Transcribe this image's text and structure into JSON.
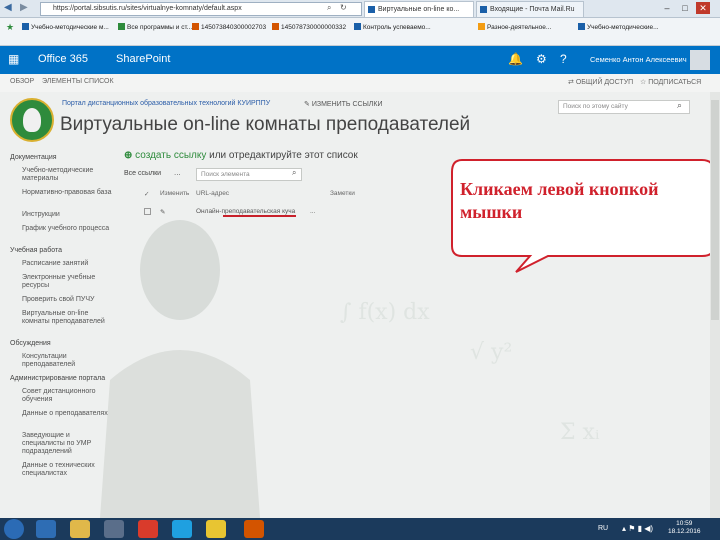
{
  "browser": {
    "address": "https://portal.sibsutis.ru/sites/virtualnye-komnaty/default.aspx",
    "tabs": [
      "Виртуальные on-line ко...",
      "Входящие - Почта Mail.Ru"
    ],
    "tab_colors": [
      "#1a5fa8",
      "#1a5fa8"
    ],
    "favorites": [
      "Учебно-методические м...",
      "Все программы и ст...",
      "145073840300002703",
      "145078730000000332",
      "Контроль успеваемо...",
      "Разное-деятельное...",
      "Учебно-методические..."
    ]
  },
  "suite": {
    "office": "Office 365",
    "app": "SharePoint",
    "user": "Семенко Антон Алексеевич",
    "bell_icon": "bell-icon",
    "gear_icon": "gear-icon",
    "help": "?"
  },
  "ribbon": {
    "left": [
      "ОБЗОР",
      "ЭЛЕМЕНТЫ",
      "СПИСОК"
    ],
    "share": "ОБЩИЙ ДОСТУП",
    "follow": "ПОДПИСАТЬСЯ"
  },
  "header": {
    "site_name": "Портал дистанционных образовательных технологий КУИРППУ",
    "edit_links": "ИЗМЕНИТЬ ССЫЛКИ",
    "title": "Виртуальные on-line комнаты преподавателей",
    "search_placeholder": "Поиск по этому сайту"
  },
  "nav": [
    {
      "label": "Документация",
      "header": true
    },
    {
      "label": "Учебно-методические материалы",
      "header": false
    },
    {
      "label": "Нормативно-правовая база",
      "header": false
    },
    {
      "label": "Инструкции",
      "header": false
    },
    {
      "label": "График учебного процесса",
      "header": false
    },
    {
      "label": "Учебная работа",
      "header": true
    },
    {
      "label": "Расписание занятий",
      "header": false
    },
    {
      "label": "Электронные учебные ресурсы",
      "header": false
    },
    {
      "label": "Проверить свой ПУЧУ",
      "header": false
    },
    {
      "label": "Виртуальные on-line комнаты преподавателей",
      "header": false
    },
    {
      "label": "Обсуждения",
      "header": true
    },
    {
      "label": "Консультации преподавателей",
      "header": false
    },
    {
      "label": "Администрирование портала",
      "header": true
    },
    {
      "label": "Совет дистанционного обучения",
      "header": false
    },
    {
      "label": "Данные о преподавателях",
      "header": false
    },
    {
      "label": "Заведующие и специалисты по УМР подразделений",
      "header": false
    },
    {
      "label": "Данные о технических специалистах",
      "header": false
    }
  ],
  "list": {
    "new_link": "создать ссылку",
    "new_suffix": " или отредактируйте этот список",
    "view_all": "Все ссылки",
    "dots": "...",
    "find_placeholder": "Поиск элемента",
    "headers": [
      "Изменить",
      "URL-адрес",
      "Заметки"
    ],
    "rows": [
      {
        "edit": "",
        "link": "Онлайн-преподавательская куча",
        "dots": "..."
      }
    ]
  },
  "callout": {
    "text": "Кликаем левой кнопкой мышки",
    "color": "#d0212c"
  },
  "taskbar": {
    "lang": "RU",
    "time": "10:59",
    "date": "18.12.2016"
  }
}
